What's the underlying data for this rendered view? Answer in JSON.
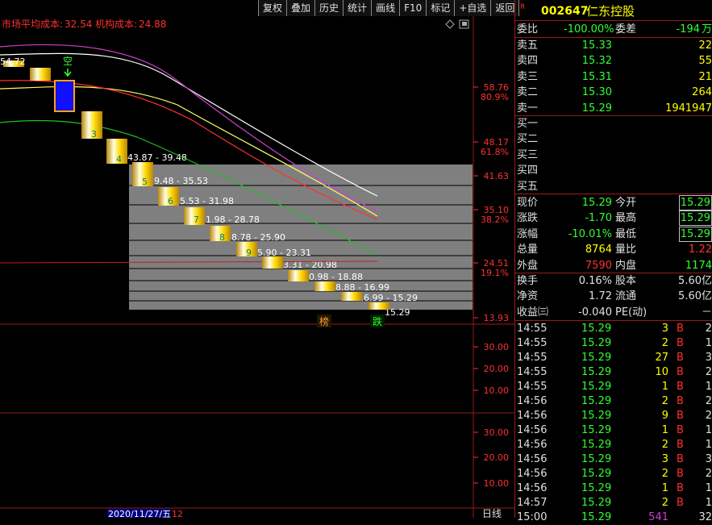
{
  "toolbar": [
    "复权",
    "叠加",
    "历史",
    "统计",
    "画线",
    "F10",
    "标记",
    "+自选",
    "返回"
  ],
  "cost_legend": {
    "market_label": "市场平均成本:",
    "market_value": "32.54",
    "inst_label": "机构成本:",
    "inst_value": "24.88"
  },
  "kline_data": {
    "price_axis": [
      {
        "price": "58.76",
        "pct": "80.9%"
      },
      {
        "price": "48.17",
        "pct": "61.8%"
      },
      {
        "price": "41.63",
        "pct": ""
      },
      {
        "price": "35.10",
        "pct": "38.2%"
      },
      {
        "price": "24.51",
        "pct": "19.1%"
      },
      {
        "price": "13.93",
        "pct": ""
      }
    ],
    "candle_numbers": [
      "3",
      "4",
      "5",
      "6",
      "7",
      "8",
      "9"
    ],
    "partial_left_label": "54.72",
    "marker_text": "空",
    "range_labels": [
      "43.87 - 39.48",
      "39.48 - 35.53",
      "35.53 - 31.98",
      "31.98 - 28.78",
      "28.78 - 25.90",
      "25.90 - 23.31",
      "23.31 - 20.98",
      "20.98 - 18.88",
      "18.88 - 16.99",
      "16.99 - 15.29",
      "15.29"
    ],
    "badges": {
      "list": "榜",
      "fall": "跌"
    }
  },
  "sub_panel_1": {
    "ticks": [
      "30.00",
      "20.00",
      "10.00"
    ]
  },
  "sub_panel_2": {
    "ticks": [
      "30.00",
      "20.00",
      "10.00"
    ]
  },
  "bottom": {
    "date": "2020/11/27/五",
    "extra": "12",
    "period": "日线"
  },
  "quote": {
    "badge": "R",
    "code": "002647",
    "name": "仁东控股",
    "weibi_label": "委比",
    "weibi_value": "-100.00%",
    "weicha_label": "委差",
    "weicha_value": "-194",
    "weicha_unit": "万",
    "asks": [
      {
        "label": "卖五",
        "price": "15.33",
        "vol": "22"
      },
      {
        "label": "卖四",
        "price": "15.32",
        "vol": "55"
      },
      {
        "label": "卖三",
        "price": "15.31",
        "vol": "21"
      },
      {
        "label": "卖二",
        "price": "15.30",
        "vol": "264"
      },
      {
        "label": "卖一",
        "price": "15.29",
        "vol": "1941947"
      }
    ],
    "bids": [
      {
        "label": "买一"
      },
      {
        "label": "买二"
      },
      {
        "label": "买三"
      },
      {
        "label": "买四"
      },
      {
        "label": "买五"
      }
    ],
    "stats": [
      {
        "l1": "现价",
        "v1": "15.29",
        "l2": "今开",
        "v2": "15.29"
      },
      {
        "l1": "涨跌",
        "v1": "-1.70",
        "l2": "最高",
        "v2": "15.29"
      },
      {
        "l1": "涨幅",
        "v1": "-10.01%",
        "l2": "最低",
        "v2": "15.29"
      },
      {
        "l1": "总量",
        "v1": "8764",
        "l2": "量比",
        "v2": "1.22"
      },
      {
        "l1": "外盘",
        "v1": "7590",
        "l2": "内盘",
        "v2": "1174"
      }
    ],
    "fin": [
      {
        "l1": "换手",
        "v1": "0.16%",
        "l2": "股本",
        "v2": "5.60亿"
      },
      {
        "l1": "净资",
        "v1": "1.72",
        "l2": "流通",
        "v2": "5.60亿"
      },
      {
        "l1": "收益㈢",
        "v1": "-0.040",
        "l2": "PE(动)",
        "v2": "－"
      }
    ],
    "ticks": [
      {
        "t": "14:55",
        "p": "15.29",
        "v": "3",
        "s": "B",
        "n": "2"
      },
      {
        "t": "14:55",
        "p": "15.29",
        "v": "2",
        "s": "B",
        "n": "1"
      },
      {
        "t": "14:55",
        "p": "15.29",
        "v": "27",
        "s": "B",
        "n": "3"
      },
      {
        "t": "14:55",
        "p": "15.29",
        "v": "10",
        "s": "B",
        "n": "2"
      },
      {
        "t": "14:55",
        "p": "15.29",
        "v": "1",
        "s": "B",
        "n": "1"
      },
      {
        "t": "14:56",
        "p": "15.29",
        "v": "2",
        "s": "B",
        "n": "2"
      },
      {
        "t": "14:56",
        "p": "15.29",
        "v": "9",
        "s": "B",
        "n": "2"
      },
      {
        "t": "14:56",
        "p": "15.29",
        "v": "1",
        "s": "B",
        "n": "1"
      },
      {
        "t": "14:56",
        "p": "15.29",
        "v": "2",
        "s": "B",
        "n": "1"
      },
      {
        "t": "14:56",
        "p": "15.29",
        "v": "3",
        "s": "B",
        "n": "3"
      },
      {
        "t": "14:56",
        "p": "15.29",
        "v": "2",
        "s": "B",
        "n": "2"
      },
      {
        "t": "14:56",
        "p": "15.29",
        "v": "1",
        "s": "B",
        "n": "1"
      },
      {
        "t": "14:57",
        "p": "15.29",
        "v": "2",
        "s": "B",
        "n": "1"
      },
      {
        "t": "15:00",
        "p": "15.29",
        "v": "541",
        "s": "",
        "n": "32"
      }
    ]
  },
  "colors": {
    "up": "#ff3030",
    "down": "#00e000",
    "accent": "#ffff00",
    "grid": "#9a1b1b",
    "candle_gold": "#ffd700",
    "candle_blue": "#1010ff",
    "range_fill": "#808080"
  }
}
